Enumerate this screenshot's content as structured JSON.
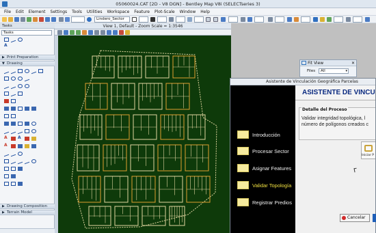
{
  "window": {
    "title": "05060024.CAT [2D - V8 DGN] - Bentley Map V8i (SELECTseries 3)"
  },
  "menu": [
    "File",
    "Edit",
    "Element",
    "Settings",
    "Tools",
    "Utilities",
    "Workspace",
    "Feature",
    "Plot-Scale",
    "Window",
    "Help"
  ],
  "toolbar": {
    "level_value": "Lindero_Sector"
  },
  "tasks": {
    "header": "Tasks",
    "dropdown": "Tasks",
    "sections": [
      "Print Preparation",
      "Drawing",
      "Drawing Composition",
      "Terrain Model"
    ]
  },
  "view": {
    "title": "View 1, Default - Zoom Scale = 1:3546"
  },
  "fit_view": {
    "title": "Fit View",
    "files_label": "Files",
    "files_value": "All"
  },
  "asistente": {
    "window_title": "Asistente de Vinculación Geográfica Parcelas",
    "header": "ASISTENTE DE VINCULACIÓN",
    "steps": [
      {
        "label": "Introducción",
        "active": false
      },
      {
        "label": "Procesar Sector",
        "active": false
      },
      {
        "label": "Asignar Features",
        "active": false
      },
      {
        "label": "Validar Topología",
        "active": true
      },
      {
        "label": "Registrar Predios",
        "active": false
      }
    ],
    "detalle": {
      "title": "Detalle del Proceso",
      "text_line1": "Validar integridad topológica, l",
      "text_line2": "número de polígonos creados c"
    },
    "start_button": "Iniciar P",
    "cancel_button": "Cancelar"
  },
  "colors": {
    "map_background": "#0e3a0a",
    "map_lines": "#e2d6a0",
    "map_highlight": "#e0a030",
    "wizard_accent": "#f0e040"
  }
}
